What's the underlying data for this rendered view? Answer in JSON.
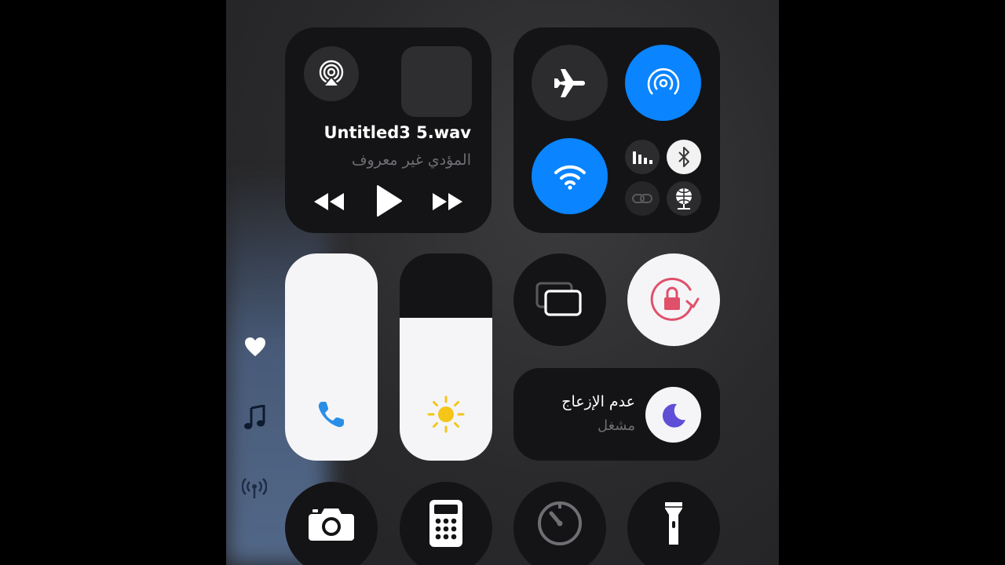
{
  "now_playing": {
    "title": "Untitled3 5.wav",
    "artist": "المؤدي غير معروف",
    "controls": {
      "previous": "rewind-icon",
      "play": "play-icon",
      "next": "fast-forward-icon"
    },
    "airplay_icon": "airplay-icon"
  },
  "connectivity": {
    "airplane_mode": {
      "icon": "airplane-icon",
      "on": false
    },
    "airdrop": {
      "icon": "airdrop-icon",
      "on": true
    },
    "wifi": {
      "icon": "wifi-icon",
      "on": true
    },
    "cellular": {
      "icon": "cellular-signal-icon",
      "on": false
    },
    "bluetooth": {
      "icon": "bluetooth-icon",
      "on": true
    },
    "personal_hotspot": {
      "icon": "hotspot-link-icon",
      "on": false
    },
    "vpn": {
      "icon": "globe-network-icon",
      "on": true
    }
  },
  "sliders": {
    "volume": {
      "icon": "phone-icon",
      "level": 1.0
    },
    "brightness": {
      "icon": "sun-icon",
      "level": 0.69
    }
  },
  "screen_mirroring": {
    "icon": "screen-mirroring-icon"
  },
  "orientation_lock": {
    "icon": "orientation-lock-icon",
    "on": true
  },
  "focus": {
    "title": "عدم الإزعاج",
    "status": "مشغل",
    "icon": "moon-icon"
  },
  "side_rail": {
    "icons": [
      "heart-icon",
      "music-note-icon",
      "broadcast-icon"
    ]
  },
  "bottom_row": {
    "icons": [
      "camera-icon",
      "calculator-icon",
      "timer-icon",
      "flashlight-icon"
    ]
  },
  "colors": {
    "accent_blue": "#0a84ff",
    "lock_red": "#e0506a",
    "moon_purple": "#5e4fd6",
    "sun_yellow": "#f5c518",
    "phone_blue": "#2a8ee8"
  }
}
